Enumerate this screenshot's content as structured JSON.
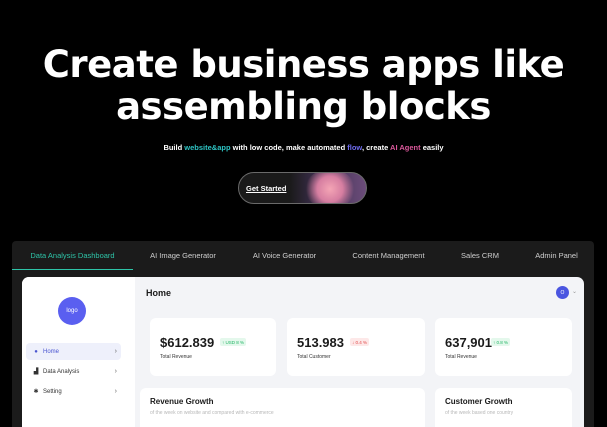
{
  "hero": {
    "title_line1": "Create business apps like",
    "title_line2": "assembling blocks",
    "sub_part1": "Build ",
    "sub_hl1": "website&app",
    "sub_part2": " with low code, make automated ",
    "sub_hl2": "flow",
    "sub_part3": ", create ",
    "sub_hl3": "AI Agent",
    "sub_part4": " easily",
    "cta_label": "Get Started"
  },
  "tabs": [
    {
      "label": "Data Analysis Dashboard",
      "active": true
    },
    {
      "label": "AI Image Generator"
    },
    {
      "label": "AI Voice Generator"
    },
    {
      "label": "Content Management"
    },
    {
      "label": "Sales CRM"
    },
    {
      "label": "Admin Panel"
    }
  ],
  "sidebar": {
    "logo": "logo",
    "items": [
      {
        "label": "Home",
        "icon": "home-icon",
        "active": true
      },
      {
        "label": "Data Analysis",
        "icon": "bar-chart-icon"
      },
      {
        "label": "Setting",
        "icon": "gear-icon"
      }
    ]
  },
  "main": {
    "title": "Home",
    "avatar": "O",
    "stats": [
      {
        "value": "$612.839",
        "badge": "↑ USD 8 %",
        "trend": "up",
        "label": "Total Revenue"
      },
      {
        "value": "513.983",
        "badge": "↓ 0.4 %",
        "trend": "down",
        "label": "Total Customer"
      },
      {
        "value": "637,901",
        "badge": "↑ 0.8 %",
        "trend": "up",
        "label": "Total Revenue"
      }
    ],
    "revenue_growth": {
      "title": "Revenue Growth",
      "subtitle": "of the week on website and compared with e-commerce"
    },
    "customer_growth": {
      "title": "Customer Growth",
      "subtitle": "of the week based one country"
    }
  }
}
